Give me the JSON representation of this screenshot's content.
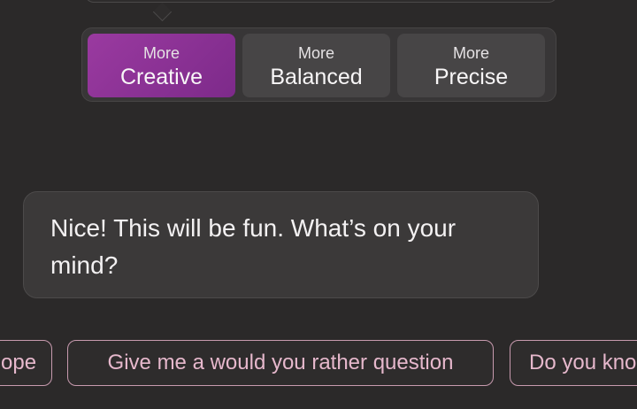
{
  "tone_selector": {
    "options": [
      {
        "small": "More",
        "big": "Creative",
        "selected": true
      },
      {
        "small": "More",
        "big": "Balanced",
        "selected": false
      },
      {
        "small": "More",
        "big": "Precise",
        "selected": false
      }
    ],
    "active_color": "#8e2f94"
  },
  "message": {
    "text": "Nice! This will be fun. What’s on your mind?"
  },
  "suggestions": [
    "ope",
    "Give me a would you rather question",
    "Do you kno"
  ],
  "colors": {
    "background": "#2b2929",
    "chip_border": "#c79aae",
    "chip_text": "#e6b8cc"
  }
}
